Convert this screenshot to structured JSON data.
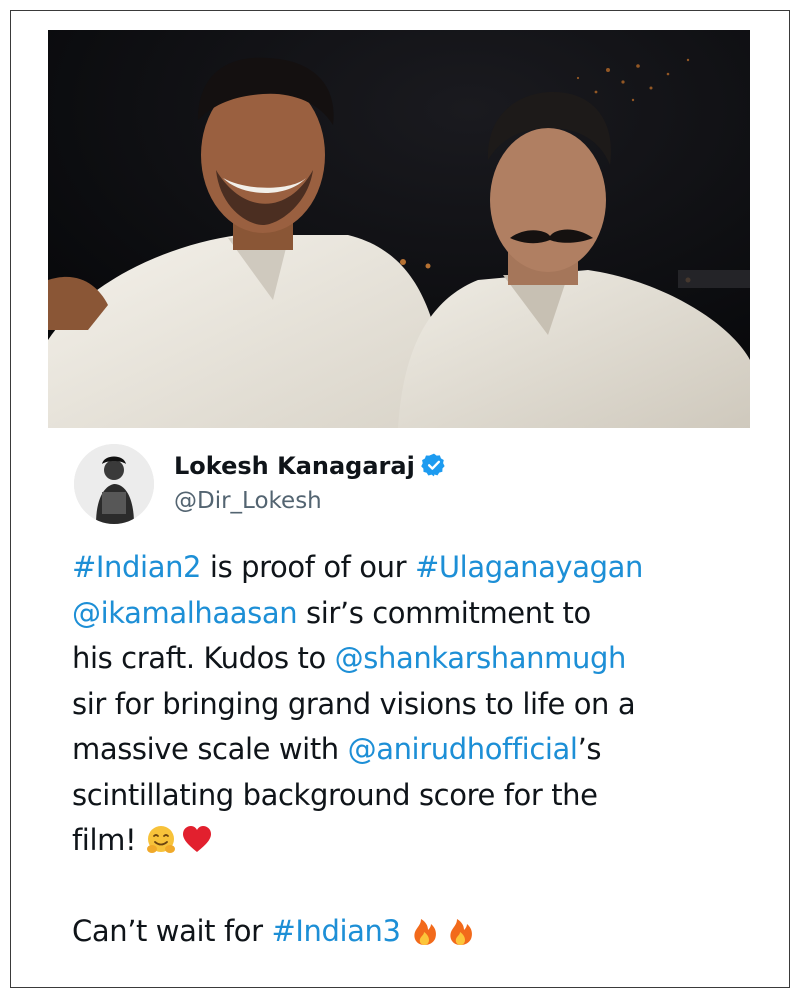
{
  "post": {
    "author_name": "Lokesh Kanagaraj",
    "author_handle": "@Dir_Lokesh",
    "verified": true,
    "image_description_icon": "photo",
    "text": {
      "line1_tag1": "#Indian2",
      "line1_mid": " is proof of our ",
      "line1_tag2": "#Ulaganayagan",
      "line2_mention": "@ikamalhaasan",
      "line2_rest": " sir’s commitment to",
      "line3_text": "his craft. Kudos to ",
      "line3_mention": "@shankarshanmugh",
      "line4_text": "sir for bringing grand visions to life on a",
      "line5_text": "massive scale with ",
      "line5_mention": "@anirudhofficial",
      "line5_end": "’s",
      "line6_text": "scintillating background score for the",
      "line7_text": "film! ",
      "line9_text": "Can’t wait for ",
      "line9_tag": "#Indian3"
    },
    "emojis": [
      "hugging-face",
      "red-heart",
      "fire",
      "fire"
    ]
  },
  "colors": {
    "link": "#1d8fd6",
    "text": "#0f1419",
    "handle": "#536471",
    "verified_badge": "#1d9bf0"
  }
}
